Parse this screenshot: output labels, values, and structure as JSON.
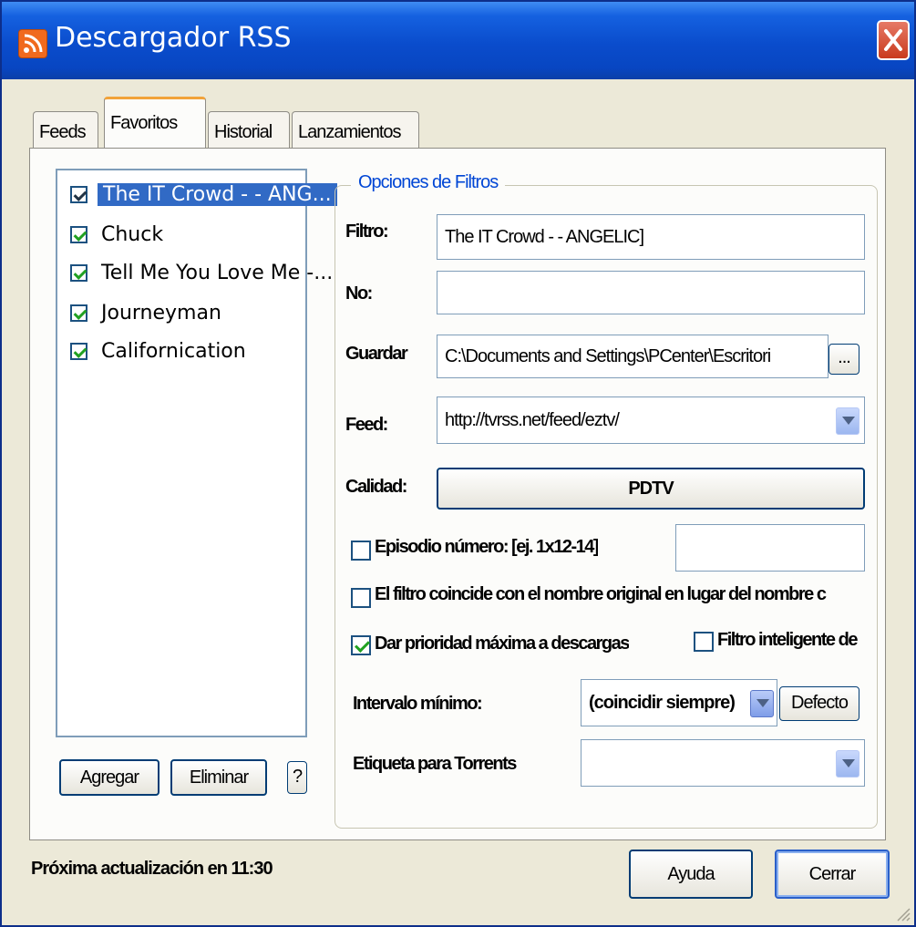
{
  "window": {
    "title": "Descargador RSS"
  },
  "tabs": [
    {
      "label": "Feeds"
    },
    {
      "label": "Favoritos",
      "active": true
    },
    {
      "label": "Historial"
    },
    {
      "label": "Lanzamientos"
    }
  ],
  "favorites": [
    {
      "label": "The IT Crowd - - ANG...",
      "checked": true,
      "selected": true
    },
    {
      "label": "Chuck",
      "checked": true
    },
    {
      "label": "Tell Me You Love Me -...",
      "checked": true
    },
    {
      "label": "Journeyman",
      "checked": true
    },
    {
      "label": "Californication",
      "checked": true
    }
  ],
  "list_buttons": {
    "add": "Agregar",
    "remove": "Eliminar",
    "help": "?"
  },
  "filter_options": {
    "group_title": "Opciones de Filtros",
    "filter_label": "Filtro:",
    "filter_value": "The IT Crowd - - ANGELIC]",
    "no_label": "No:",
    "no_value": "",
    "save_label": "Guardar",
    "save_value": "C:\\Documents and Settings\\PCenter\\Escritori",
    "browse_label": "...",
    "feed_label": "Feed:",
    "feed_value": "http://tvrss.net/feed/eztv/",
    "quality_label": "Calidad:",
    "quality_value": "PDTV",
    "episode_label": "Episodio número: [ej. 1x12-14]",
    "episode_checked": false,
    "episode_value": "",
    "original_name_label": "El filtro coincide con el nombre original en lugar del nombre c",
    "original_name_checked": false,
    "priority_label": "Dar prioridad máxima a descargas",
    "priority_checked": true,
    "smart_filter_label": "Filtro inteligente de",
    "smart_filter_checked": false,
    "interval_label": "Intervalo mínimo:",
    "interval_value": "(coincidir siempre)",
    "default_button": "Defecto",
    "torrent_label": "Etiqueta para Torrents",
    "torrent_value": ""
  },
  "status": {
    "next_update": "Próxima actualización en 11:30"
  },
  "footer_buttons": {
    "help": "Ayuda",
    "close": "Cerrar"
  },
  "colors": {
    "titlebar": "#0a4ccc",
    "selection": "#316ac5",
    "group_title": "#0046d5",
    "tab_accent": "#f2a33a"
  }
}
